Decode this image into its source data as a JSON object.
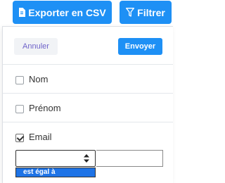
{
  "toolbar": {
    "export_label": "Exporter en CSV",
    "filter_label": "Filtrer"
  },
  "panel": {
    "cancel_label": "Annuler",
    "send_label": "Envoyer",
    "fields": [
      {
        "label": "Nom",
        "checked": false
      },
      {
        "label": "Prénom",
        "checked": false
      },
      {
        "label": "Email",
        "checked": true
      }
    ],
    "operator": {
      "selected": "",
      "options": [
        "est égal à"
      ],
      "value": ""
    }
  },
  "colors": {
    "primary": "#1e90f5",
    "cancel_text": "#6f63c9",
    "option_highlight": "#1e73e6"
  }
}
